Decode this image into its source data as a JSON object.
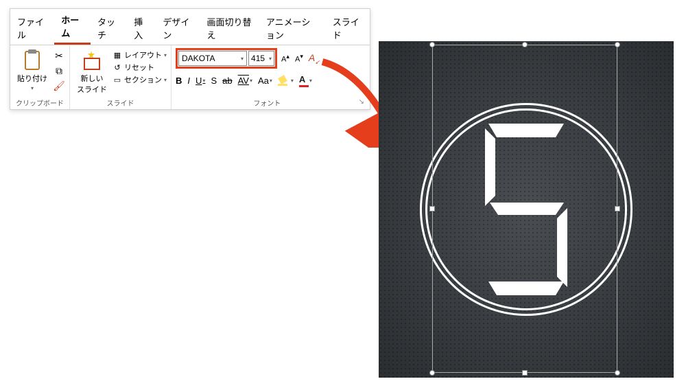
{
  "tabs": {
    "file": "ファイル",
    "home": "ホーム",
    "touch": "タッチ",
    "insert": "挿入",
    "design": "デザイン",
    "transition": "画面切り替え",
    "animation": "アニメーション",
    "slideshow": "スライド"
  },
  "clipboard": {
    "paste": "貼り付け",
    "group_label": "クリップボード"
  },
  "slides": {
    "new_slide": "新しい\nスライド",
    "layout": "レイアウト",
    "reset": "リセット",
    "section": "セクション",
    "group_label": "スライド"
  },
  "font": {
    "name": "DAKOTA",
    "size": "415",
    "grow": "A^",
    "shrink": "A˅",
    "clear": "A",
    "bold": "B",
    "italic": "I",
    "underline": "U",
    "strike": "S",
    "strike2": "ab",
    "spacing": "AV",
    "case": "Aa",
    "group_label": "フォント"
  },
  "preview": {
    "digit": "5"
  }
}
